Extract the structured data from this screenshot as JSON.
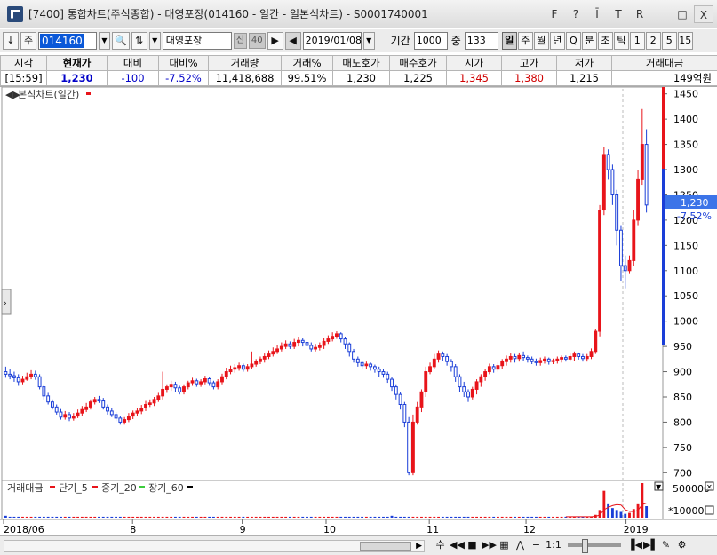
{
  "window": {
    "title": "[7400] 통합차트(주식종합) - 대영포장(014160 - 일간 - 일본식차트) - S0001740001",
    "tools": [
      "F",
      "?",
      "Ī",
      "T",
      "R",
      "_",
      "□",
      "X"
    ]
  },
  "toolbar": {
    "down_arrow": "↓",
    "market_select": "주",
    "stock_code": "014160",
    "stock_name": "대영포장",
    "tag_credit": "신",
    "tag_number": "40",
    "date": "2019/01/08",
    "period_label": "기간",
    "period_value": "1000",
    "count_label": "중",
    "count_value": "133",
    "period_buttons": [
      {
        "label": "일",
        "active": true
      },
      {
        "label": "주",
        "active": false
      },
      {
        "label": "월",
        "active": false
      },
      {
        "label": "년",
        "active": false
      },
      {
        "label": "Q",
        "active": false
      },
      {
        "label": "분",
        "active": false
      },
      {
        "label": "초",
        "active": false
      },
      {
        "label": "틱",
        "active": false
      },
      {
        "label": "1",
        "active": false
      },
      {
        "label": "2",
        "active": false
      },
      {
        "label": "5",
        "active": false
      },
      {
        "label": "15",
        "active": false
      }
    ]
  },
  "quote": {
    "headers": [
      "시각",
      "현재가",
      "대비",
      "대비%",
      "거래량",
      "거래%",
      "매도호가",
      "매수호가",
      "시가",
      "고가",
      "저가",
      "거래대금"
    ],
    "values": [
      "[15:59]",
      "1,230",
      "-100",
      "-7.52%",
      "11,418,688",
      "99.51%",
      "1,230",
      "1,225",
      "1,345",
      "1,380",
      "1,215",
      "149억원"
    ]
  },
  "chart": {
    "title": "본식차트(일간)",
    "current_price": "1,230",
    "current_change": "-7.52%",
    "y_ticks": [
      "1450",
      "1400",
      "1350",
      "1300",
      "1250",
      "1200",
      "1150",
      "1100",
      "1050",
      "1000",
      "950",
      "900",
      "850",
      "800",
      "750",
      "700"
    ],
    "x_ticks": [
      "2018/06",
      "8",
      "9",
      "10",
      "11",
      "12",
      "2019"
    ],
    "volume_legend": {
      "main": "거래대금",
      "ma5": "단기_5",
      "ma20": "중기_20",
      "ma60": "장기_60"
    },
    "volume_ticks": [
      "500000",
      "*100000"
    ],
    "colors": {
      "up": "#e8141a",
      "down": "#1a3ed8",
      "ma5": "#e8141a",
      "ma20": "#d01010",
      "ma60": "#3ccc3c",
      "ma_black": "#000000",
      "price_tag": "#3c74e8"
    }
  },
  "bottom": {
    "zoom_ratio": "1:1"
  },
  "chart_data": {
    "type": "candlestick",
    "title": "본식차트(일간)",
    "y_range": [
      690,
      1460
    ],
    "x_labels": [
      "2018/06",
      "8",
      "9",
      "10",
      "11",
      "12",
      "2019"
    ],
    "candles": [
      [
        900,
        895,
        910,
        888
      ],
      [
        895,
        892,
        905,
        885
      ],
      [
        892,
        888,
        900,
        880
      ],
      [
        888,
        880,
        895,
        872
      ],
      [
        880,
        885,
        892,
        875
      ],
      [
        885,
        890,
        898,
        882
      ],
      [
        890,
        895,
        903,
        885
      ],
      [
        895,
        890,
        902,
        884
      ],
      [
        890,
        870,
        895,
        865
      ],
      [
        870,
        852,
        875,
        845
      ],
      [
        852,
        840,
        858,
        835
      ],
      [
        840,
        830,
        845,
        825
      ],
      [
        830,
        820,
        835,
        815
      ],
      [
        820,
        810,
        826,
        805
      ],
      [
        810,
        815,
        822,
        805
      ],
      [
        815,
        808,
        820,
        802
      ],
      [
        808,
        812,
        818,
        803
      ],
      [
        812,
        818,
        825,
        808
      ],
      [
        818,
        825,
        832,
        812
      ],
      [
        825,
        830,
        838,
        820
      ],
      [
        830,
        840,
        845,
        825
      ],
      [
        840,
        845,
        850,
        835
      ],
      [
        845,
        842,
        852,
        838
      ],
      [
        842,
        830,
        848,
        825
      ],
      [
        830,
        822,
        835,
        815
      ],
      [
        822,
        815,
        828,
        810
      ],
      [
        815,
        808,
        820,
        802
      ],
      [
        808,
        800,
        812,
        795
      ],
      [
        800,
        805,
        810,
        795
      ],
      [
        805,
        812,
        818,
        800
      ],
      [
        812,
        818,
        823,
        806
      ],
      [
        818,
        822,
        828,
        812
      ],
      [
        822,
        828,
        834,
        816
      ],
      [
        828,
        835,
        842,
        822
      ],
      [
        835,
        838,
        845,
        830
      ],
      [
        838,
        845,
        850,
        832
      ],
      [
        845,
        852,
        858,
        840
      ],
      [
        852,
        865,
        900,
        845
      ],
      [
        865,
        870,
        875,
        858
      ],
      [
        870,
        875,
        882,
        862
      ],
      [
        875,
        868,
        880,
        860
      ],
      [
        868,
        860,
        872,
        855
      ],
      [
        860,
        870,
        875,
        855
      ],
      [
        870,
        878,
        882,
        865
      ],
      [
        878,
        882,
        888,
        872
      ],
      [
        882,
        876,
        886,
        870
      ],
      [
        876,
        880,
        885,
        870
      ],
      [
        880,
        886,
        892,
        875
      ],
      [
        886,
        878,
        890,
        872
      ],
      [
        878,
        870,
        882,
        865
      ],
      [
        870,
        880,
        885,
        865
      ],
      [
        880,
        890,
        896,
        875
      ],
      [
        890,
        900,
        908,
        885
      ],
      [
        900,
        905,
        912,
        895
      ],
      [
        905,
        908,
        915,
        898
      ],
      [
        908,
        912,
        918,
        902
      ],
      [
        912,
        905,
        916,
        900
      ],
      [
        905,
        910,
        915,
        900
      ],
      [
        910,
        915,
        940,
        905
      ],
      [
        915,
        920,
        925,
        910
      ],
      [
        920,
        925,
        930,
        915
      ],
      [
        925,
        930,
        936,
        918
      ],
      [
        930,
        935,
        942,
        925
      ],
      [
        935,
        940,
        948,
        930
      ],
      [
        940,
        945,
        952,
        935
      ],
      [
        945,
        950,
        958,
        940
      ],
      [
        950,
        955,
        962,
        945
      ],
      [
        955,
        950,
        960,
        945
      ],
      [
        950,
        958,
        965,
        945
      ],
      [
        958,
        962,
        968,
        950
      ],
      [
        962,
        958,
        966,
        950
      ],
      [
        958,
        952,
        962,
        945
      ],
      [
        952,
        945,
        958,
        940
      ],
      [
        945,
        948,
        955,
        940
      ],
      [
        948,
        952,
        958,
        942
      ],
      [
        952,
        960,
        966,
        945
      ],
      [
        960,
        965,
        972,
        955
      ],
      [
        965,
        970,
        978,
        960
      ],
      [
        970,
        975,
        980,
        965
      ],
      [
        975,
        965,
        978,
        958
      ],
      [
        965,
        955,
        968,
        945
      ],
      [
        955,
        940,
        958,
        930
      ],
      [
        940,
        925,
        945,
        918
      ],
      [
        925,
        918,
        930,
        910
      ],
      [
        918,
        912,
        922,
        905
      ],
      [
        912,
        915,
        920,
        905
      ],
      [
        915,
        910,
        918,
        902
      ],
      [
        910,
        905,
        914,
        898
      ],
      [
        905,
        900,
        910,
        890
      ],
      [
        900,
        895,
        905,
        888
      ],
      [
        895,
        885,
        900,
        878
      ],
      [
        885,
        870,
        890,
        862
      ],
      [
        870,
        855,
        875,
        845
      ],
      [
        855,
        835,
        860,
        825
      ],
      [
        835,
        800,
        840,
        790
      ],
      [
        800,
        700,
        810,
        695
      ],
      [
        700,
        800,
        815,
        695
      ],
      [
        800,
        830,
        840,
        795
      ],
      [
        830,
        860,
        865,
        820
      ],
      [
        860,
        900,
        910,
        850
      ],
      [
        900,
        910,
        918,
        895
      ],
      [
        910,
        925,
        935,
        905
      ],
      [
        925,
        935,
        942,
        918
      ],
      [
        935,
        930,
        940,
        922
      ],
      [
        930,
        920,
        935,
        912
      ],
      [
        920,
        910,
        925,
        900
      ],
      [
        910,
        890,
        915,
        880
      ],
      [
        890,
        870,
        895,
        860
      ],
      [
        870,
        860,
        880,
        850
      ],
      [
        860,
        850,
        865,
        840
      ],
      [
        850,
        865,
        870,
        845
      ],
      [
        865,
        880,
        885,
        855
      ],
      [
        880,
        890,
        895,
        870
      ],
      [
        890,
        900,
        905,
        882
      ],
      [
        900,
        910,
        916,
        895
      ],
      [
        910,
        905,
        915,
        898
      ],
      [
        905,
        912,
        918,
        900
      ],
      [
        912,
        920,
        925,
        905
      ],
      [
        920,
        925,
        932,
        912
      ],
      [
        925,
        930,
        936,
        918
      ],
      [
        930,
        926,
        935,
        918
      ],
      [
        926,
        932,
        938,
        920
      ],
      [
        932,
        928,
        940,
        922
      ],
      [
        928,
        925,
        932,
        918
      ],
      [
        925,
        920,
        930,
        915
      ],
      [
        920,
        918,
        926,
        912
      ],
      [
        918,
        922,
        928,
        912
      ],
      [
        922,
        925,
        930,
        916
      ],
      [
        925,
        920,
        928,
        914
      ],
      [
        920,
        922,
        926,
        915
      ],
      [
        922,
        925,
        930,
        916
      ],
      [
        925,
        928,
        932,
        918
      ],
      [
        928,
        925,
        932,
        920
      ],
      [
        925,
        930,
        936,
        920
      ],
      [
        930,
        935,
        940,
        922
      ],
      [
        935,
        930,
        938,
        924
      ],
      [
        930,
        926,
        935,
        920
      ],
      [
        926,
        930,
        935,
        920
      ],
      [
        930,
        940,
        946,
        925
      ],
      [
        940,
        980,
        985,
        935
      ],
      [
        980,
        1220,
        1230,
        970
      ],
      [
        1220,
        1330,
        1345,
        1210
      ],
      [
        1330,
        1300,
        1340,
        1280
      ],
      [
        1300,
        1250,
        1310,
        1230
      ],
      [
        1250,
        1180,
        1260,
        1150
      ],
      [
        1180,
        1110,
        1190,
        1080
      ],
      [
        1110,
        1100,
        1130,
        1065
      ],
      [
        1100,
        1120,
        1130,
        1095
      ],
      [
        1120,
        1200,
        1220,
        1110
      ],
      [
        1200,
        1280,
        1300,
        1190
      ],
      [
        1280,
        1350,
        1420,
        1270
      ],
      [
        1350,
        1230,
        1380,
        1215
      ]
    ],
    "volume": [
      2,
      1,
      1,
      1,
      1,
      1,
      1,
      1,
      1,
      1,
      1,
      1,
      1,
      1,
      1,
      1,
      1,
      1,
      1,
      1,
      1,
      1,
      1,
      1,
      1,
      1,
      1,
      1,
      1,
      1,
      1,
      1,
      1,
      1,
      1,
      1,
      1,
      1,
      1,
      1,
      1,
      1,
      1,
      1,
      1,
      1,
      1,
      1,
      1,
      1,
      1,
      1,
      1,
      1,
      1,
      1,
      1,
      1,
      1,
      1,
      1,
      1,
      1,
      1,
      1,
      1,
      1,
      1,
      1,
      1,
      1,
      1,
      1,
      1,
      1,
      1,
      1,
      1,
      1,
      1,
      1,
      1,
      1,
      1,
      1,
      1,
      1,
      1,
      1,
      1,
      1,
      2,
      1,
      1,
      1,
      1,
      1,
      1,
      1,
      1,
      1,
      1,
      1,
      1,
      1,
      1,
      1,
      1,
      1,
      1,
      1,
      1,
      1,
      1,
      1,
      1,
      1,
      1,
      1,
      1,
      1,
      1,
      1,
      1,
      1,
      1,
      1,
      1,
      1,
      1,
      1,
      1,
      1,
      1,
      1,
      1,
      1,
      1,
      1,
      3,
      8,
      28,
      14,
      10,
      8,
      6,
      4,
      5,
      9,
      14,
      36,
      12
    ]
  }
}
